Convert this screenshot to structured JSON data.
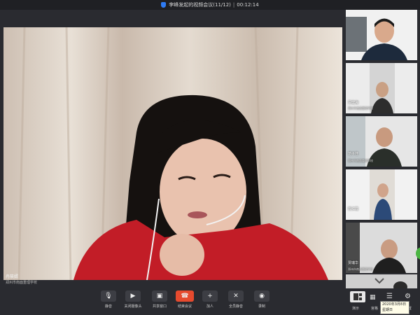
{
  "title_bar": {
    "title": "李峰发起的视频会议(11/12)",
    "separator": "|",
    "timer": "00:12:14"
  },
  "main_video": {
    "speaker_name": "冉筱婿",
    "speaker_org": "郑州市南面重理学校",
    "next_arrow": "›"
  },
  "reserved_label": "钉钉",
  "tiles": [
    {
      "name": "",
      "org": ""
    },
    {
      "name": "贾健海",
      "org": "郑州市南面重理学校"
    },
    {
      "name": "范子佳",
      "org": "郑州市南面重理学校"
    },
    {
      "name": "陈红霞",
      "org": ""
    },
    {
      "name": "贾瑞华",
      "org": "郑州市南面重理学校"
    },
    {
      "name": "",
      "org": ""
    }
  ],
  "toolbar": {
    "buttons": [
      {
        "label": "静音",
        "icon": "microphone-icon",
        "glyph": "🎙"
      },
      {
        "label": "关闭摄像头",
        "icon": "camera-icon",
        "glyph": "▶"
      },
      {
        "label": "共享窗口",
        "icon": "share-screen-icon",
        "glyph": "▣"
      },
      {
        "label": "结束会议",
        "icon": "hangup-icon",
        "glyph": "☎"
      },
      {
        "label": "加人",
        "icon": "add-person-icon",
        "glyph": "+"
      },
      {
        "label": "全员静音",
        "icon": "mute-all-icon",
        "glyph": "✕"
      },
      {
        "label": "录制",
        "icon": "record-icon",
        "glyph": "◉"
      }
    ],
    "layout_label": "演示",
    "grid_label": "宫格",
    "settings_label": "设置"
  },
  "date_tooltip": {
    "date": "2020年3月8日",
    "weekday": "星期日"
  },
  "colors": {
    "end_call": "#e64a2e",
    "accent": "#2e7cf6",
    "handle": "#4bb543"
  }
}
